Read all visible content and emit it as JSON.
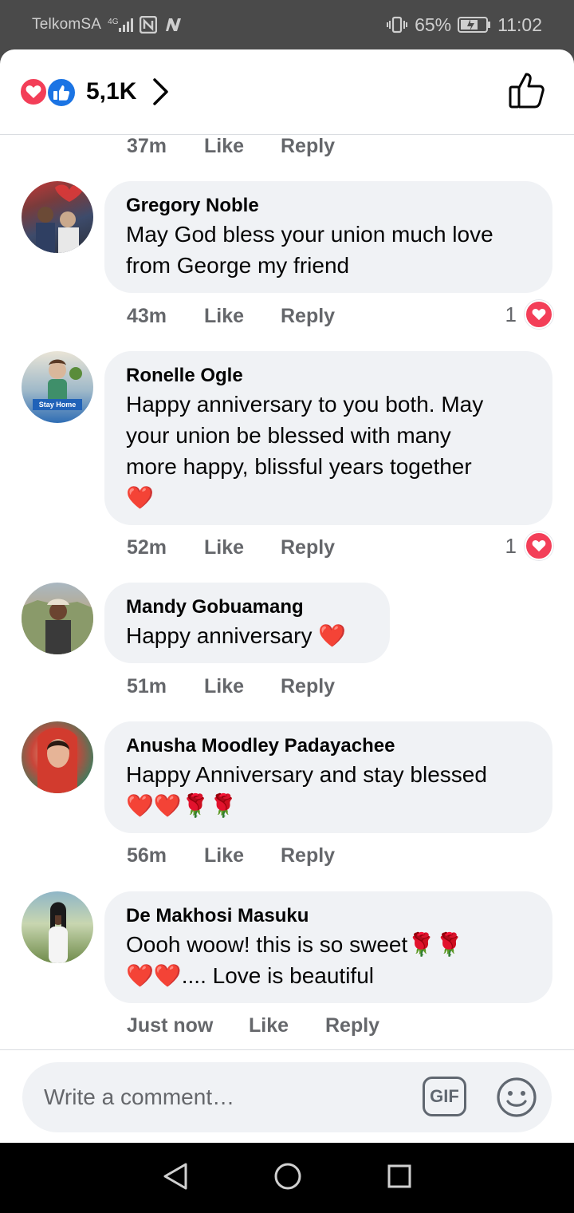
{
  "status_bar": {
    "carrier": "TelkomSA",
    "network": "4G",
    "battery_pct": "65%",
    "time": "11:02"
  },
  "header": {
    "reaction_total": "5,1K",
    "reaction_icons": [
      "love-icon",
      "like-icon"
    ]
  },
  "comments": [
    {
      "author": "",
      "text": "",
      "time": "37m",
      "like_label": "Like",
      "reply_label": "Reply"
    },
    {
      "author": "Gregory Noble",
      "text_lines": [
        "May God  bless your union much love",
        "from George my friend"
      ],
      "time": "43m",
      "like_label": "Like",
      "reply_label": "Reply",
      "reaction_count": "1"
    },
    {
      "author": "Ronelle Ogle",
      "text_lines": [
        "Happy anniversary to you both. May",
        "your union be blessed with many",
        "more happy, blissful years together"
      ],
      "emoji_line": "❤️",
      "avatar_label": "Stay Home",
      "time": "52m",
      "like_label": "Like",
      "reply_label": "Reply",
      "reaction_count": "1"
    },
    {
      "author": "Mandy Gobuamang",
      "text_lines": [
        "Happy anniversary ❤️"
      ],
      "time": "51m",
      "like_label": "Like",
      "reply_label": "Reply"
    },
    {
      "author": "Anusha Moodley Padayachee",
      "text_lines": [
        "Happy Anniversary and stay blessed"
      ],
      "emoji_line": "❤️❤️🌹🌹",
      "time": "56m",
      "like_label": "Like",
      "reply_label": "Reply"
    },
    {
      "author": "De Makhosi Masuku",
      "text_lines": [
        "Oooh woow! this is so sweet🌹🌹",
        "❤️❤️.... Love is beautiful"
      ],
      "time": "Just now",
      "like_label": "Like",
      "reply_label": "Reply"
    }
  ],
  "composer": {
    "placeholder": "Write a comment…",
    "gif_label": "GIF"
  },
  "colors": {
    "accent_blue": "#1b74e4",
    "love_red": "#f33e58",
    "bubble_bg": "#f0f2f5",
    "meta_gray": "#65676b"
  }
}
